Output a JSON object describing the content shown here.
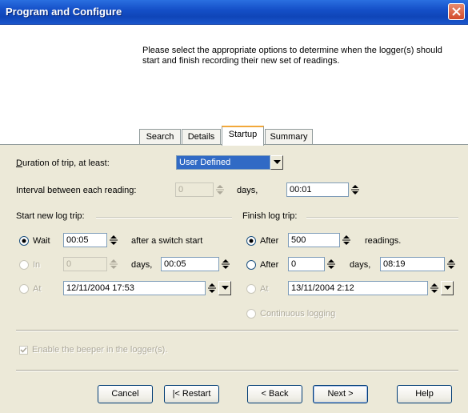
{
  "window": {
    "title": "Program and Configure"
  },
  "description": "Please select the appropriate options to determine when the logger(s) should start and finish recording their new set of readings.",
  "tabs": [
    {
      "label": "Search",
      "active": false
    },
    {
      "label": "Details",
      "active": false
    },
    {
      "label": "Startup",
      "active": true
    },
    {
      "label": "Summary",
      "active": false
    }
  ],
  "duration": {
    "label_prefix": "D",
    "label_rest": "uration of trip, at least:",
    "value": "User Defined"
  },
  "interval": {
    "label": "Interval between each reading:",
    "days_value": "0",
    "days_unit": "days,",
    "time_value": "00:01"
  },
  "start_group": {
    "title": "Start new log trip:",
    "wait": {
      "label": "Wait",
      "value": "00:05",
      "suffix": "after a switch start",
      "selected": true
    },
    "in": {
      "label": "In",
      "days_value": "0",
      "days_unit": "days,",
      "time_value": "00:05",
      "selected": false
    },
    "at": {
      "label": "At",
      "value": "12/11/2004  17:53",
      "selected": false
    }
  },
  "finish_group": {
    "title": "Finish log trip:",
    "after_readings": {
      "label": "After",
      "value": "500",
      "suffix": "readings.",
      "selected": true
    },
    "after_days": {
      "label": "After",
      "days_value": "0",
      "days_unit": "days,",
      "time_value": "08:19",
      "selected": false
    },
    "at": {
      "label": "At",
      "value": "13/11/2004   2:12",
      "selected": false
    },
    "continuous": {
      "label": "Continuous logging",
      "selected": false
    }
  },
  "beeper": {
    "label": "Enable the beeper in the logger(s).",
    "checked": true,
    "enabled": false
  },
  "buttons": {
    "cancel": "Cancel",
    "restart": "|< Restart",
    "back": "< Back",
    "next": "Next >",
    "help": "Help"
  }
}
